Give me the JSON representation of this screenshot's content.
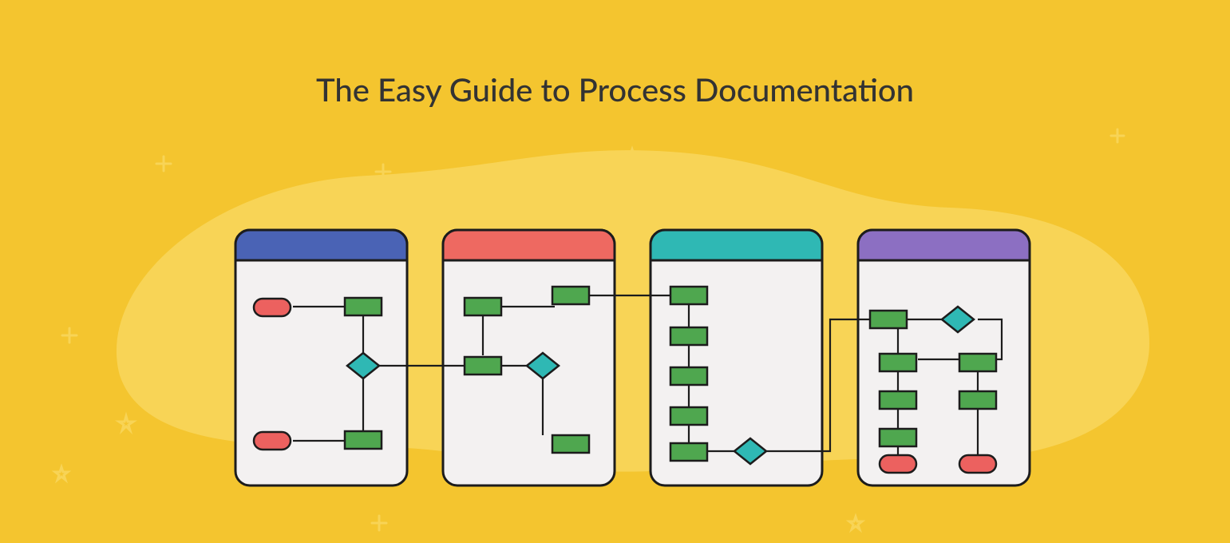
{
  "title": "The Easy Guide to Process Documentation",
  "colors": {
    "bg": "#f4c52f",
    "blob": "#f8d456",
    "card_fill": "#f3f1f1",
    "stroke": "#1c1c1c",
    "header_blue": "#4a63b5",
    "header_red": "#ee6961",
    "header_teal": "#2fb8b4",
    "header_purple": "#8c6fc2",
    "process": "#4fa74f",
    "terminator": "#ec615f",
    "decision": "#2fb8b4",
    "spark": "#f8d456"
  },
  "cards": [
    {
      "header": "header_blue"
    },
    {
      "header": "header_red"
    },
    {
      "header": "header_teal"
    },
    {
      "header": "header_purple"
    }
  ],
  "diagram": {
    "description": "Four rounded document cards with colored headers (blue, red, teal, purple). Inside and across the cards, a flowchart runs using green process boxes, teal decision diamonds, and red terminator pills, connected by thin black lines. The overall flow begins at a red terminator in card 1, passes through processes and a decision, crosses into card 2, branches at another decision, continues through card 3 as a vertical chain with a decision at the bottom linking to card 4, which has two parallel process columns ending in red terminators.",
    "shapes": {
      "process_count": 17,
      "decision_count": 4,
      "terminator_count": 4
    }
  }
}
